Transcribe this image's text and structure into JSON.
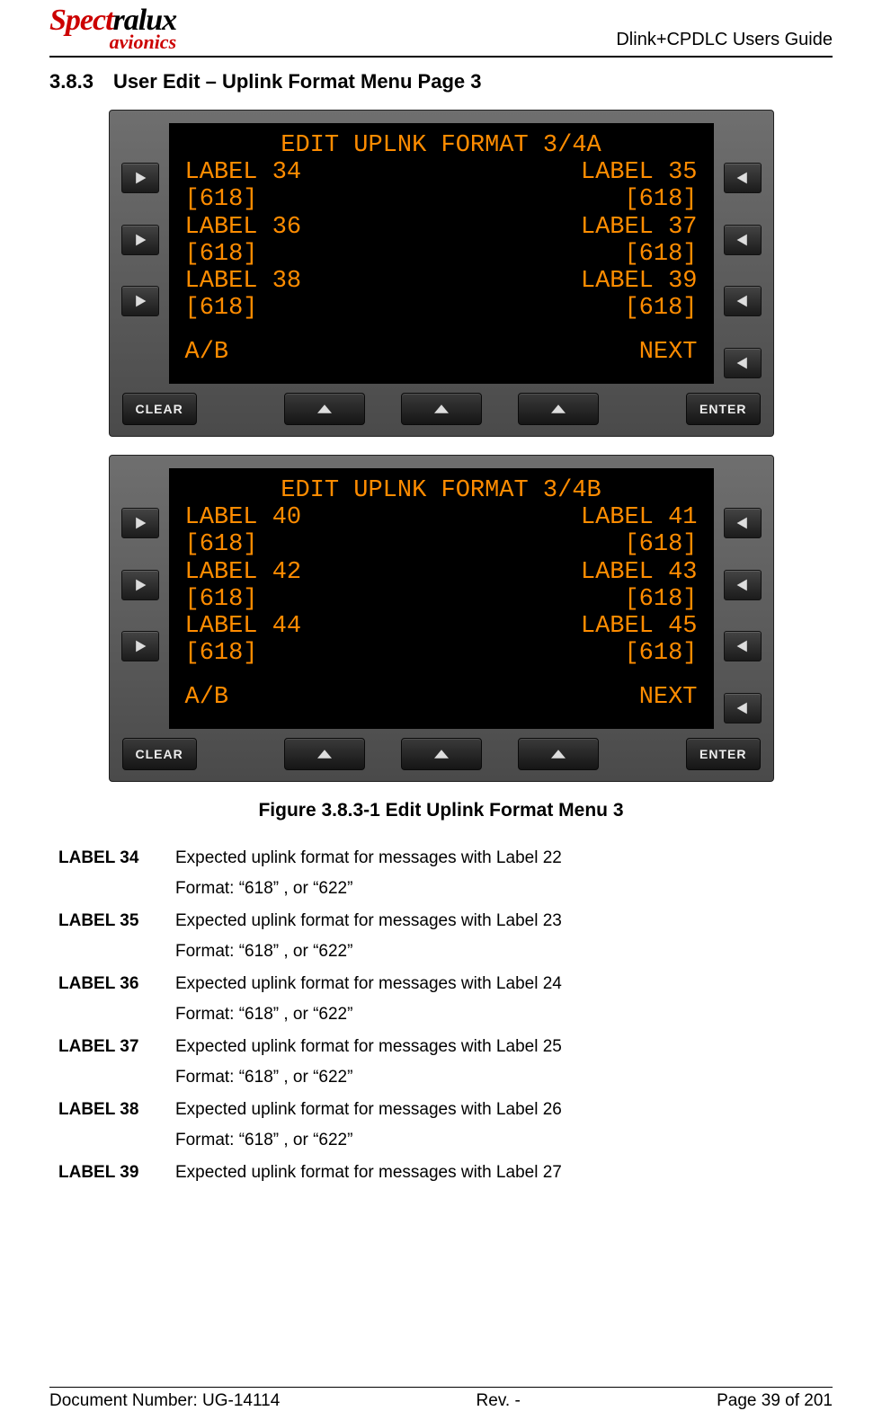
{
  "header": {
    "logo_main_a": "Spect",
    "logo_main_b": "ralux",
    "logo_sub": "avionics",
    "title": "Dlink+CPDLC Users Guide"
  },
  "section": {
    "num": "3.8.3",
    "title": "User Edit – Uplink Format Menu Page 3"
  },
  "panelA": {
    "title": "EDIT UPLNK FORMAT 3/4A",
    "l1a": "LABEL 34",
    "l1b": "LABEL 35",
    "l2a": "[618]",
    "l2b": "[618]",
    "l3a": "LABEL 36",
    "l3b": "LABEL 37",
    "l4a": "[618]",
    "l4b": "[618]",
    "l5a": "LABEL 38",
    "l5b": "LABEL 39",
    "l6a": "[618]",
    "l6b": "[618]",
    "l7a": "A/B",
    "l7b": "NEXT",
    "clear": "CLEAR",
    "enter": "ENTER"
  },
  "panelB": {
    "title": "EDIT UPLNK FORMAT 3/4B",
    "l1a": "LABEL 40",
    "l1b": "LABEL 41",
    "l2a": "[618]",
    "l2b": "[618]",
    "l3a": "LABEL 42",
    "l3b": "LABEL 43",
    "l4a": "[618]",
    "l4b": "[618]",
    "l5a": "LABEL 44",
    "l5b": "LABEL 45",
    "l6a": "[618]",
    "l6b": "[618]",
    "l7a": "A/B",
    "l7b": "NEXT",
    "clear": "CLEAR",
    "enter": "ENTER"
  },
  "caption": "Figure 3.8.3-1 Edit Uplink Format Menu 3",
  "defs": [
    {
      "term": "LABEL 34",
      "line1": "Expected uplink format for messages with Label 22",
      "line2": "Format: “618” , or “622”"
    },
    {
      "term": "LABEL 35",
      "line1": "Expected uplink format for messages with Label 23",
      "line2": "Format: “618” , or “622”"
    },
    {
      "term": "LABEL 36",
      "line1": "Expected uplink format for messages with Label 24",
      "line2": "Format: “618” , or “622”"
    },
    {
      "term": "LABEL 37",
      "line1": "Expected uplink format for messages with Label 25",
      "line2": "Format: “618” , or “622”"
    },
    {
      "term": "LABEL 38",
      "line1": "Expected uplink format for messages with Label 26",
      "line2": "Format: “618” , or “622”"
    },
    {
      "term": "LABEL 39",
      "line1": "Expected uplink format for messages with Label 27",
      "line2": ""
    }
  ],
  "footer": {
    "left": "Document Number:  UG-14114",
    "mid": "Rev. -",
    "right": "Page 39 of 201"
  }
}
